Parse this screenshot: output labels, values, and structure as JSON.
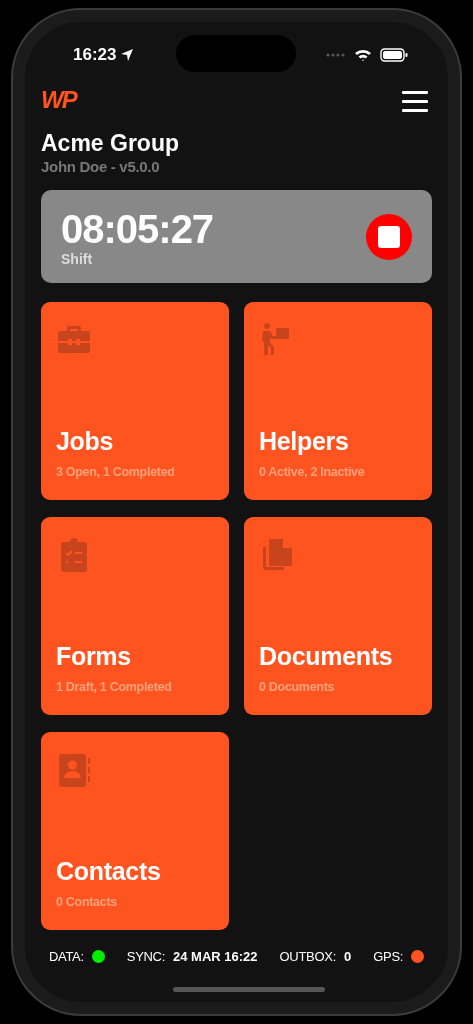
{
  "status_bar": {
    "time": "16:23"
  },
  "header": {
    "logo": "WP",
    "title": "Acme Group",
    "subtitle": "John Doe - v5.0.0"
  },
  "timer": {
    "time": "08:05:27",
    "label": "Shift",
    "running": true
  },
  "tiles": [
    {
      "kind": "jobs",
      "title": "Jobs",
      "subtitle": "3 Open, 1 Completed"
    },
    {
      "kind": "helpers",
      "title": "Helpers",
      "subtitle": "0 Active, 2 Inactive"
    },
    {
      "kind": "forms",
      "title": "Forms",
      "subtitle": "1 Draft, 1 Completed"
    },
    {
      "kind": "documents",
      "title": "Documents",
      "subtitle": "0 Documents"
    },
    {
      "kind": "contacts",
      "title": "Contacts",
      "subtitle": "0 Contacts"
    }
  ],
  "footer": [
    {
      "kind": "dot",
      "label": "DATA:",
      "color": "#00ee00"
    },
    {
      "kind": "value",
      "label": "SYNC:",
      "value": "24 MAR 16:22"
    },
    {
      "kind": "value",
      "label": "OUTBOX:",
      "value": "0"
    },
    {
      "kind": "dot",
      "label": "GPS:",
      "color": "#ff5420"
    }
  ]
}
